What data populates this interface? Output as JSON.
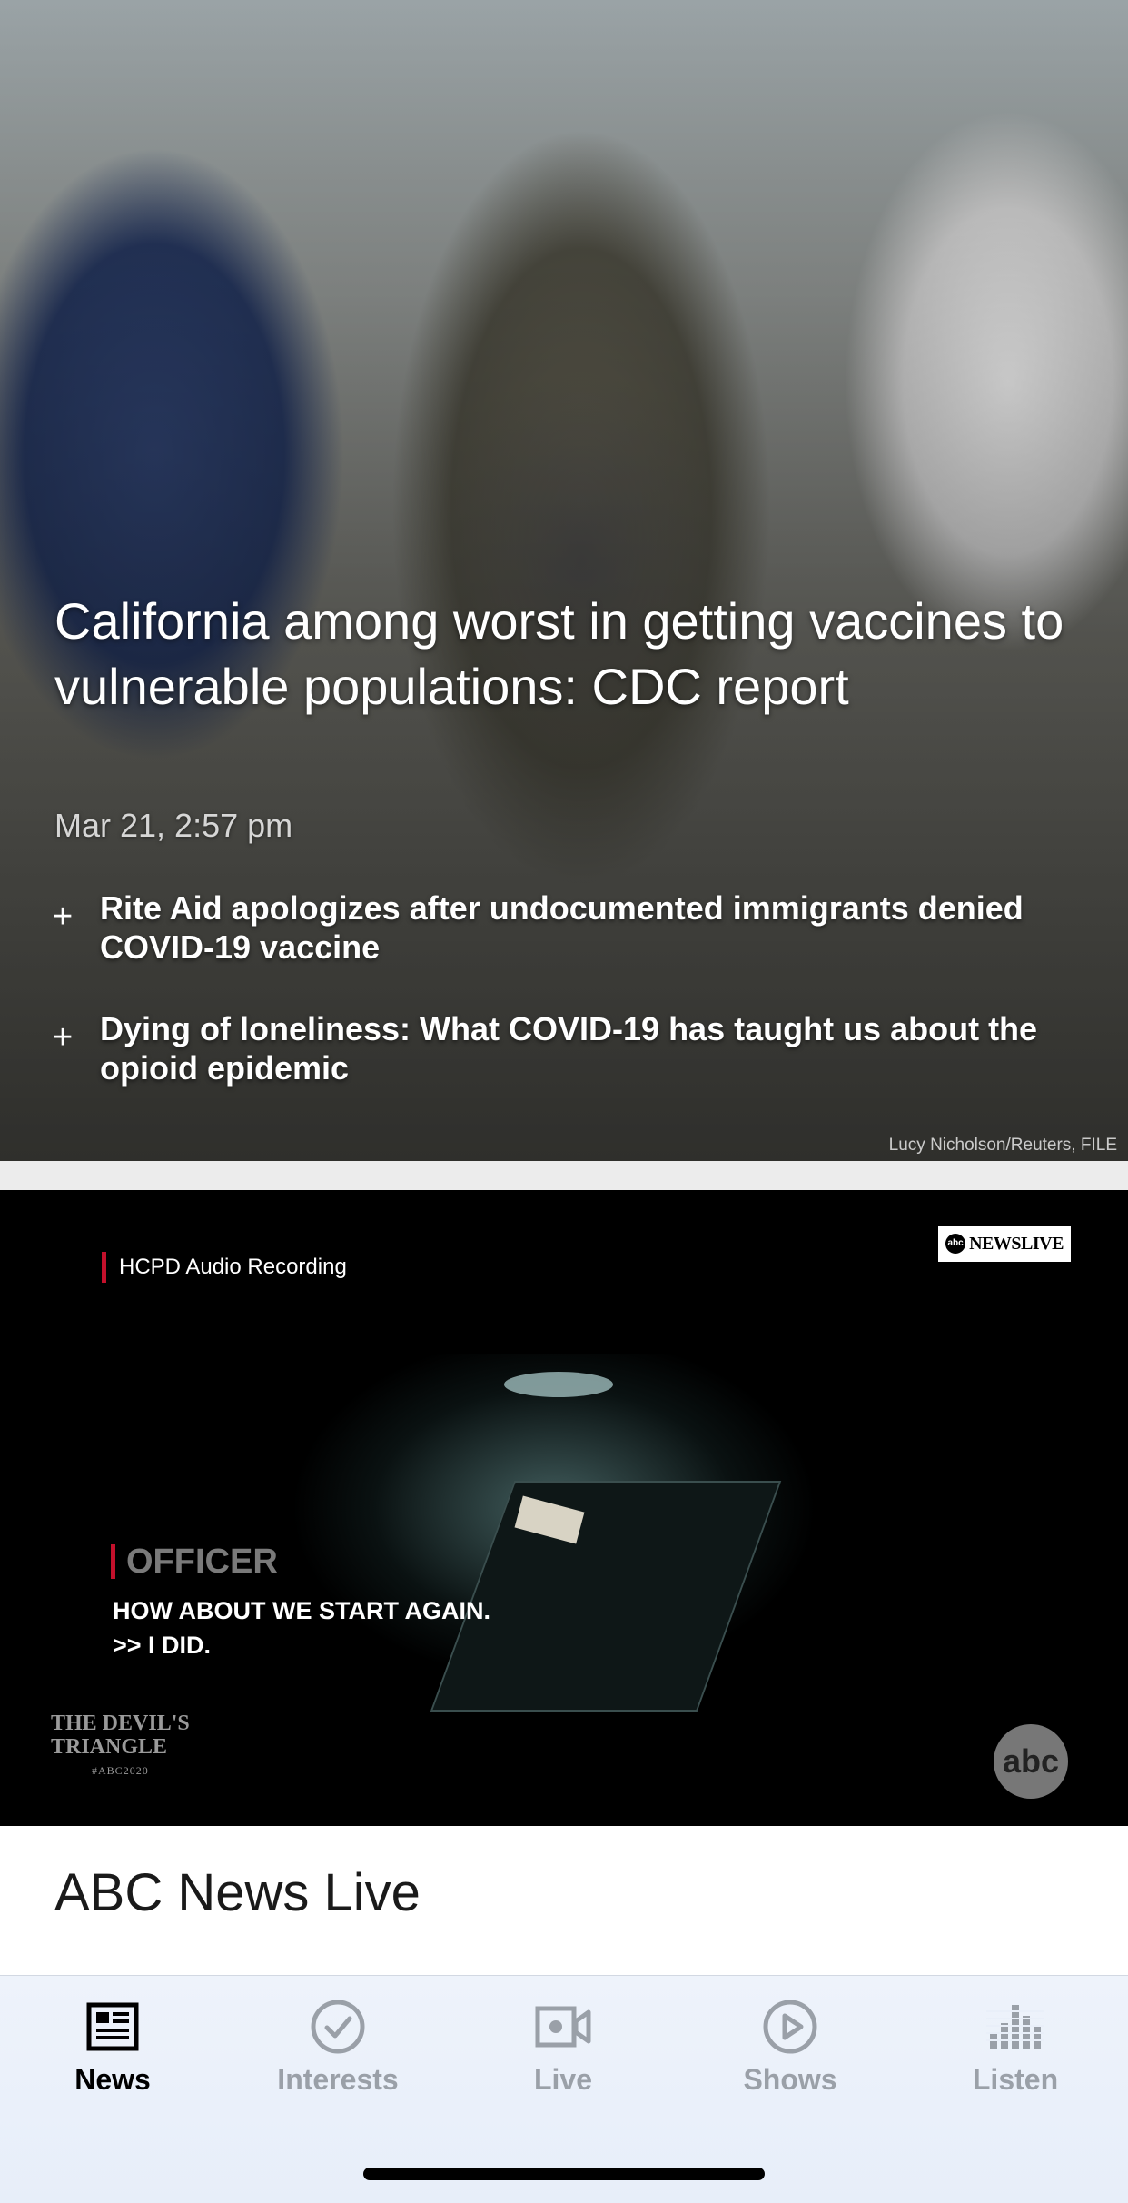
{
  "hero": {
    "headline": "California among worst in getting vaccines to vulnerable populations: CDC report",
    "timestamp": "Mar 21, 2:57 pm",
    "related": [
      {
        "text": "Rite Aid apologizes after undocumented immigrants denied COVID-19 vaccine"
      },
      {
        "text": "Dying of loneliness: What COVID-19 has taught us about the opioid epidemic"
      }
    ],
    "photo_credit": "Lucy Nicholson/Reuters, FILE"
  },
  "video": {
    "recording_label": "HCPD Audio Recording",
    "network_badge": "NEWSLIVE",
    "network_badge_logo": "abc",
    "speaker": "OFFICER",
    "caption_lines": [
      "HOW ABOUT WE START AGAIN.",
      ">> I DID."
    ],
    "show_logo_lines": [
      "THE DEVIL'S",
      "TRIANGLE",
      "#ABC2020"
    ],
    "channel_bug": "abc"
  },
  "section": {
    "title": "ABC News Live"
  },
  "tabbar": {
    "tabs": [
      {
        "label": "News",
        "icon": "newspaper-icon",
        "active": true
      },
      {
        "label": "Interests",
        "icon": "checkmark-circle-icon",
        "active": false
      },
      {
        "label": "Live",
        "icon": "video-camera-icon",
        "active": false
      },
      {
        "label": "Shows",
        "icon": "play-circle-icon",
        "active": false
      },
      {
        "label": "Listen",
        "icon": "equalizer-icon",
        "active": false
      }
    ]
  },
  "colors": {
    "accent_red": "#c3102b",
    "tab_active": "#000000",
    "tab_inactive": "#9aa0a8"
  }
}
